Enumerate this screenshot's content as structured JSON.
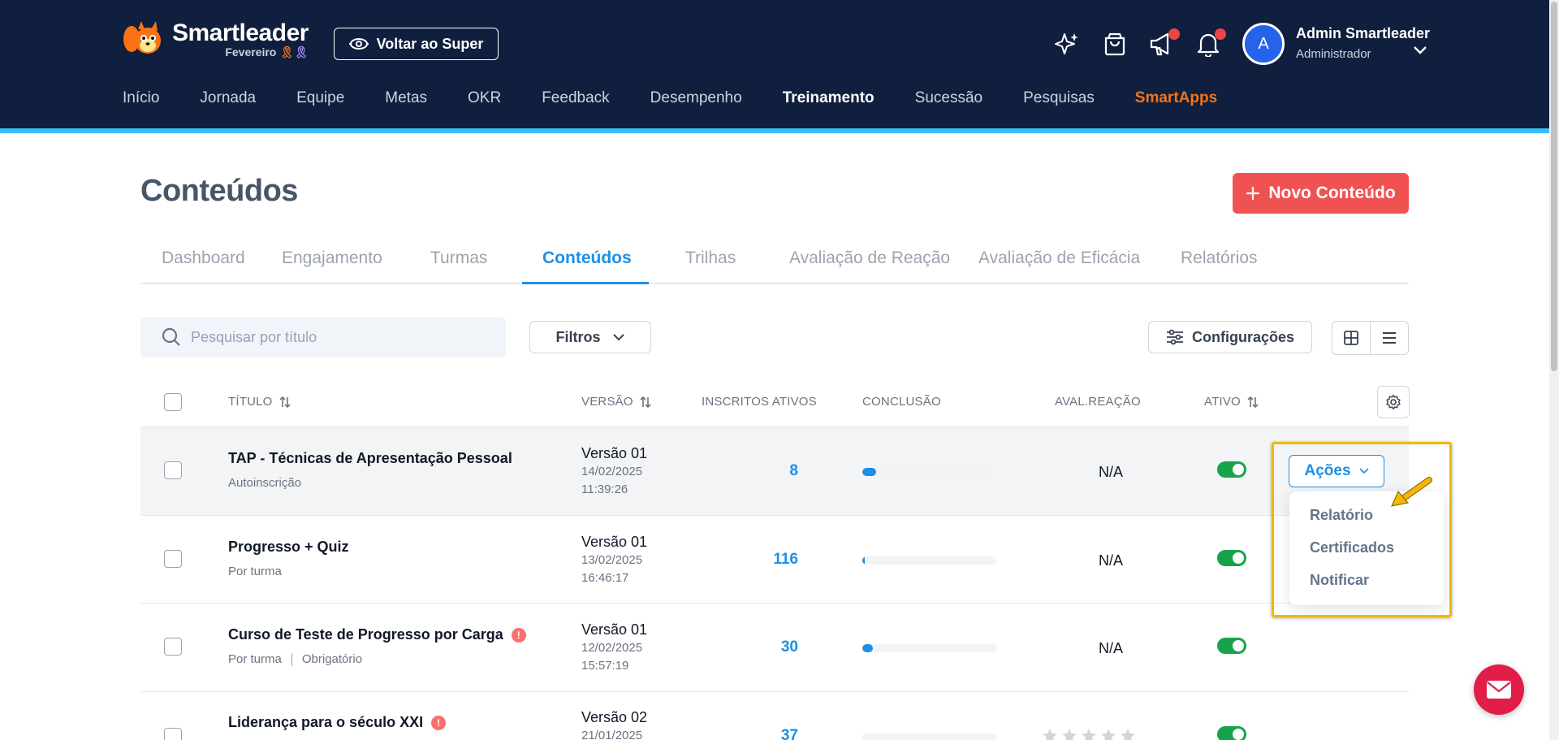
{
  "brand": {
    "name": "Smartleader",
    "subtitle": "Fevereiro",
    "ribbon1": "🎗",
    "ribbon2": "🎗"
  },
  "header": {
    "super_button": "Voltar ao Super",
    "user_name": "Admin Smartleader",
    "user_role": "Administrador",
    "avatar_initial": "A",
    "nav": [
      "Início",
      "Jornada",
      "Equipe",
      "Metas",
      "OKR",
      "Feedback",
      "Desempenho",
      "Treinamento",
      "Sucessão",
      "Pesquisas",
      "SmartApps"
    ]
  },
  "page": {
    "title": "Conteúdos",
    "new_button": "Novo Conteúdo",
    "tabs": [
      "Dashboard",
      "Engajamento",
      "Turmas",
      "Conteúdos",
      "Trilhas",
      "Avaliação de Reação",
      "Avaliação de Eficácia",
      "Relatórios"
    ],
    "search_placeholder": "Pesquisar por título",
    "filters_label": "Filtros",
    "config_label": "Configurações"
  },
  "table": {
    "columns": {
      "title": "Título",
      "version": "Versão",
      "enrolled": "Inscritos ativos",
      "completion": "Conclusão",
      "reaction": "Aval.reação",
      "active": "Ativo"
    },
    "rows": [
      {
        "title": "TAP - Técnicas de Apresentação Pessoal",
        "tag1": "Autoinscrição",
        "tag2": "",
        "version": "Versão 01",
        "date": "14/02/2025",
        "time": "11:39:26",
        "enrolled": "8",
        "completion": 0.1,
        "reaction": "N/A"
      },
      {
        "title": "Progresso + Quiz",
        "tag1": "Por turma",
        "tag2": "",
        "version": "Versão 01",
        "date": "13/02/2025",
        "time": "16:46:17",
        "enrolled": "116",
        "completion": 0.01,
        "reaction": "N/A"
      },
      {
        "title": "Curso de Teste de Progresso por Carga",
        "tag1": "Por turma",
        "tag2": "Obrigatório",
        "alert": "!",
        "version": "Versão 01",
        "date": "12/02/2025",
        "time": "15:57:19",
        "enrolled": "30",
        "completion": 0.08,
        "reaction": "N/A"
      },
      {
        "title": "Liderança para o século XXI",
        "tag1": "",
        "tag2": "",
        "alert": "!",
        "version": "Versão 02",
        "date": "21/01/2025",
        "time": "",
        "enrolled": "37",
        "completion": 0,
        "reaction": ""
      }
    ]
  },
  "actions": {
    "button": "Ações",
    "menu": [
      "Relatório",
      "Certificados",
      "Notificar"
    ]
  },
  "colors": {
    "header_bg": "#0f1f3d",
    "accent_blue": "#1d8fe4",
    "primary_red": "#f05252",
    "toggle_green": "#16a34a",
    "highlight": "#f2b705",
    "smartapps": "#f97316"
  }
}
